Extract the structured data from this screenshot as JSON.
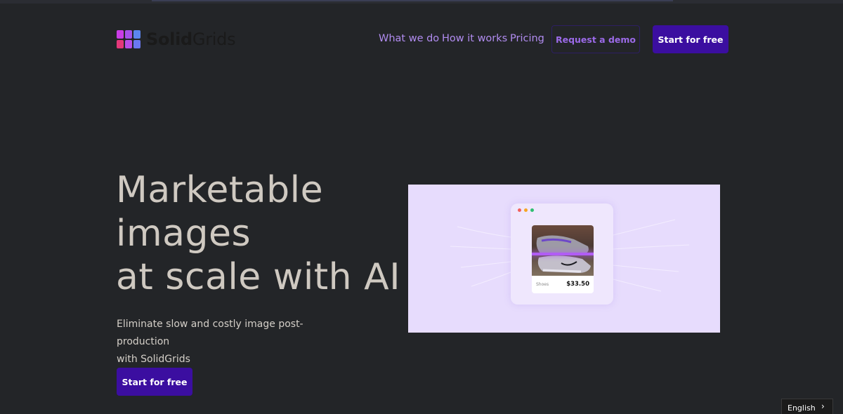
{
  "brand": {
    "name_bold": "Solid",
    "name_light": "Grids",
    "logo_colors": [
      "#c93ce6",
      "#a552ea",
      "#5b86f0",
      "#e4387a",
      "#b84ee8",
      "#6a78f2"
    ]
  },
  "nav": {
    "items": [
      {
        "label": "What we do"
      },
      {
        "label": "How it works"
      },
      {
        "label": "Pricing"
      }
    ],
    "demo_button": "Request a demo",
    "start_button": "Start for free"
  },
  "hero": {
    "title_lines": [
      "Marketable",
      "images",
      "at scale with AI"
    ],
    "subtitle_line1": "Eliminate slow and costly image post-production",
    "subtitle_line2": "with SolidGrids",
    "cta": "Start for free"
  },
  "illustration": {
    "window_dots": [
      "#f25f5c",
      "#f6a623",
      "#2fbf71"
    ],
    "product_label": "Shoes",
    "product_price": "$33.50"
  },
  "language": {
    "selected": "English"
  },
  "colors": {
    "background": "#232528",
    "accent": "#3b0ea0",
    "link": "#b18cf0"
  }
}
